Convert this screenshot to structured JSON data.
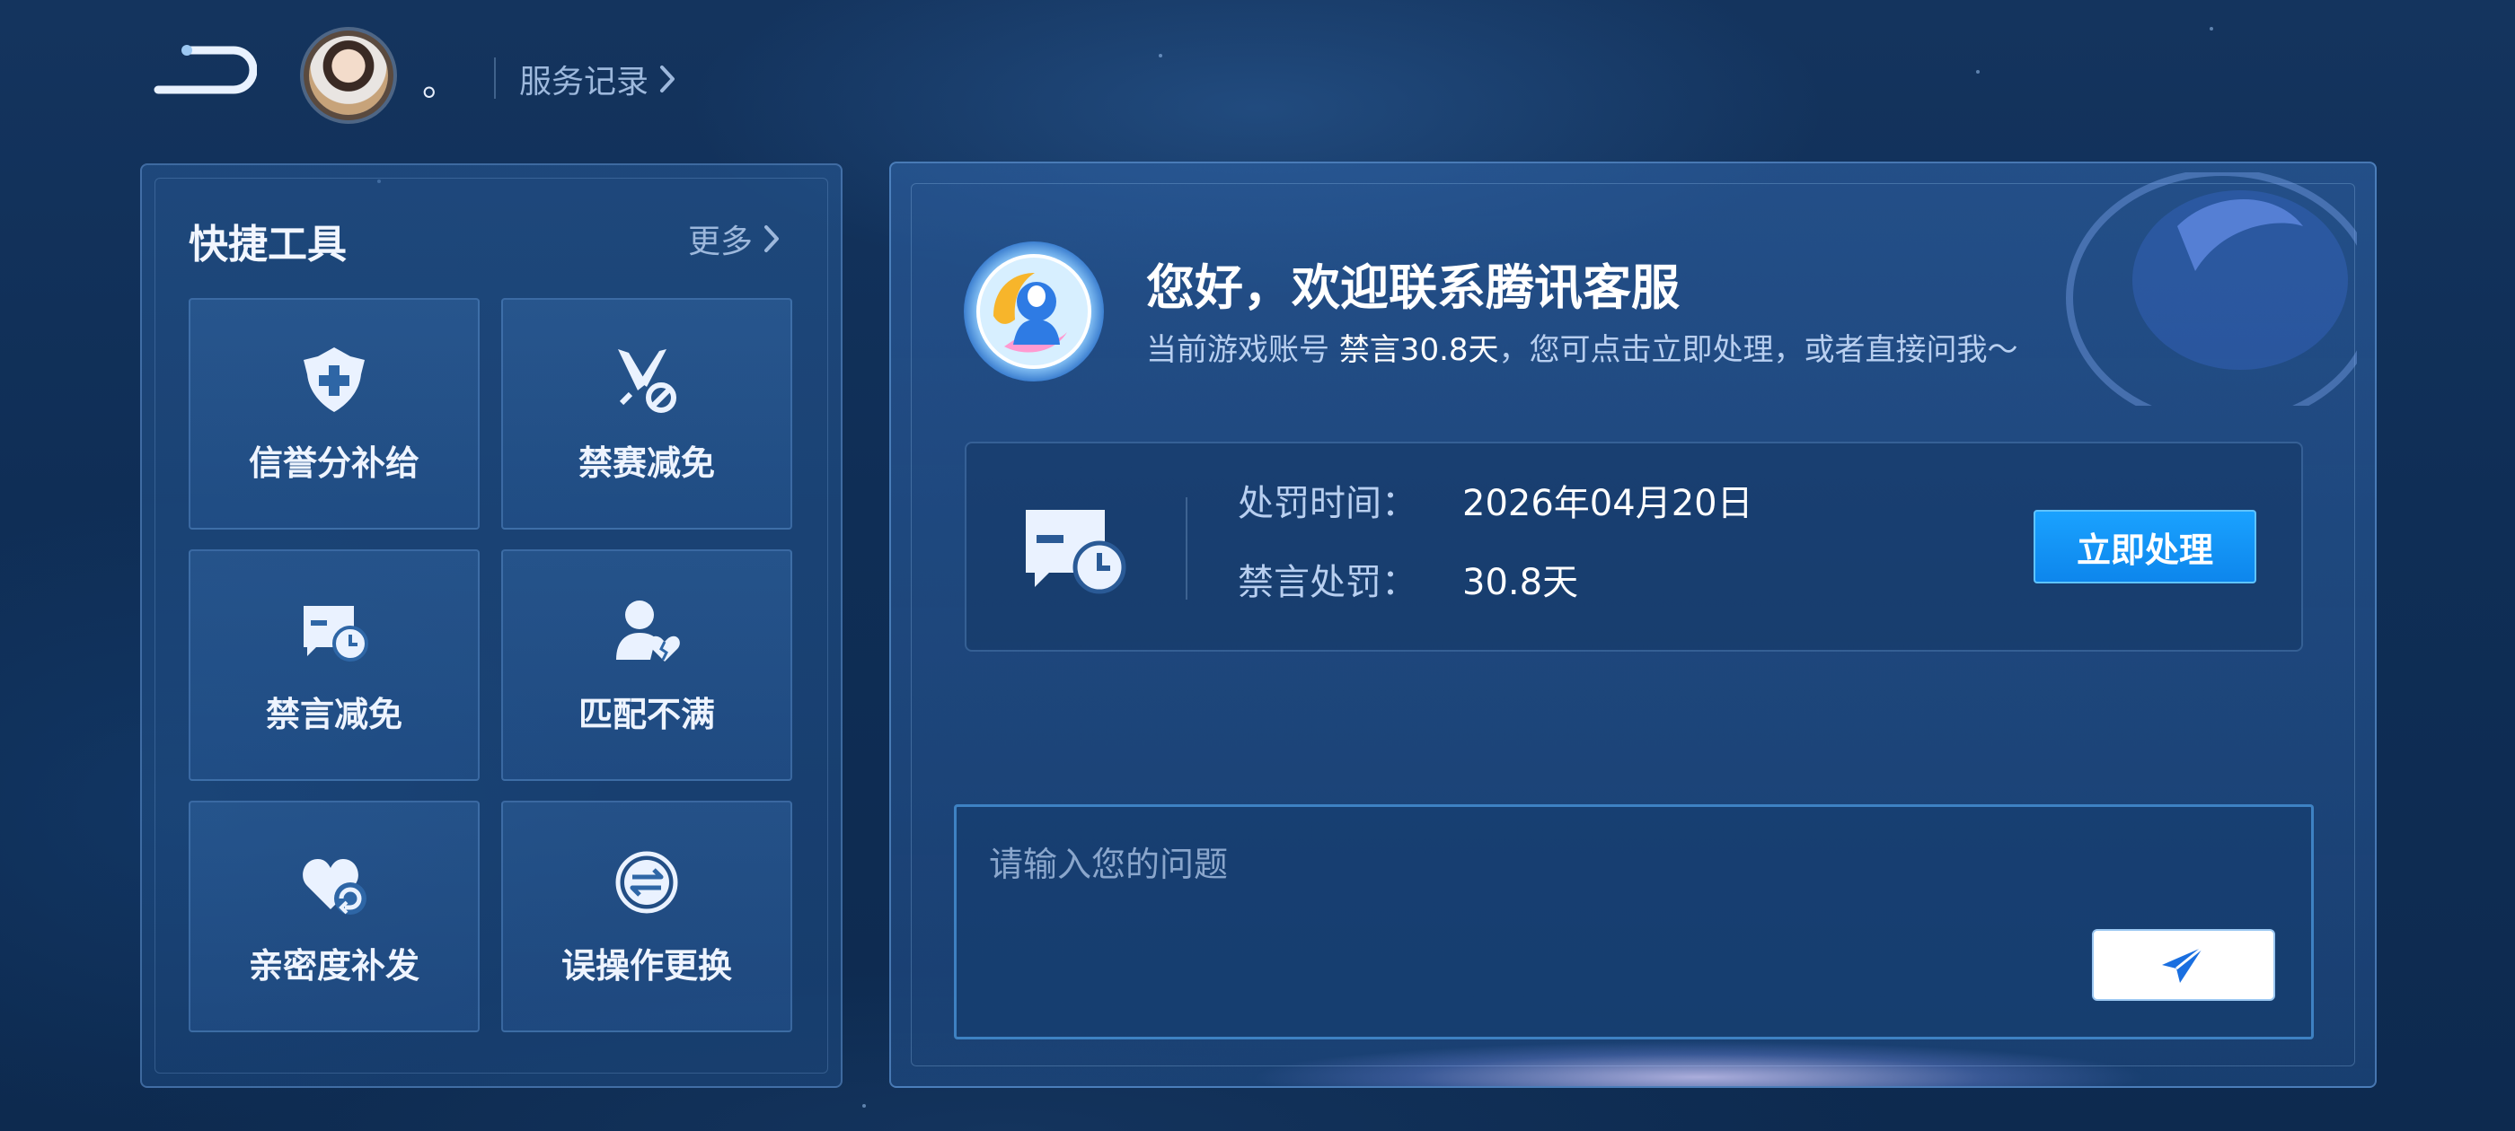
{
  "header": {
    "username": "。",
    "service_record_label": "服务记录"
  },
  "quick_tools": {
    "title": "快捷工具",
    "more_label": "更多",
    "items": [
      {
        "label": "信誉分补给",
        "icon": "shield-plus-icon"
      },
      {
        "label": "禁赛减免",
        "icon": "sword-ban-icon"
      },
      {
        "label": "禁言减免",
        "icon": "chat-clock-icon"
      },
      {
        "label": "匹配不满",
        "icon": "user-broken-heart-icon"
      },
      {
        "label": "亲密度补发",
        "icon": "heart-return-icon"
      },
      {
        "label": "误操作更换",
        "icon": "swap-circle-icon"
      }
    ]
  },
  "chat": {
    "greeting": "您好，欢迎联系腾讯客服",
    "sub_prefix": "当前游戏账号 ",
    "sub_highlight": "禁言30.8天",
    "sub_suffix": "，您可点击立即处理，或者直接问我～",
    "penalty": {
      "time_label": "处罚时间：",
      "time_value": "2026年04月20日",
      "type_label": "禁言处罚：",
      "type_value": "30.8天",
      "action_label": "立即处理"
    },
    "input_placeholder": "请输入您的问题"
  },
  "colors": {
    "accent_button": "#0d86ec",
    "background": "#0f2e56",
    "panel_border": "#6ea5e6"
  }
}
